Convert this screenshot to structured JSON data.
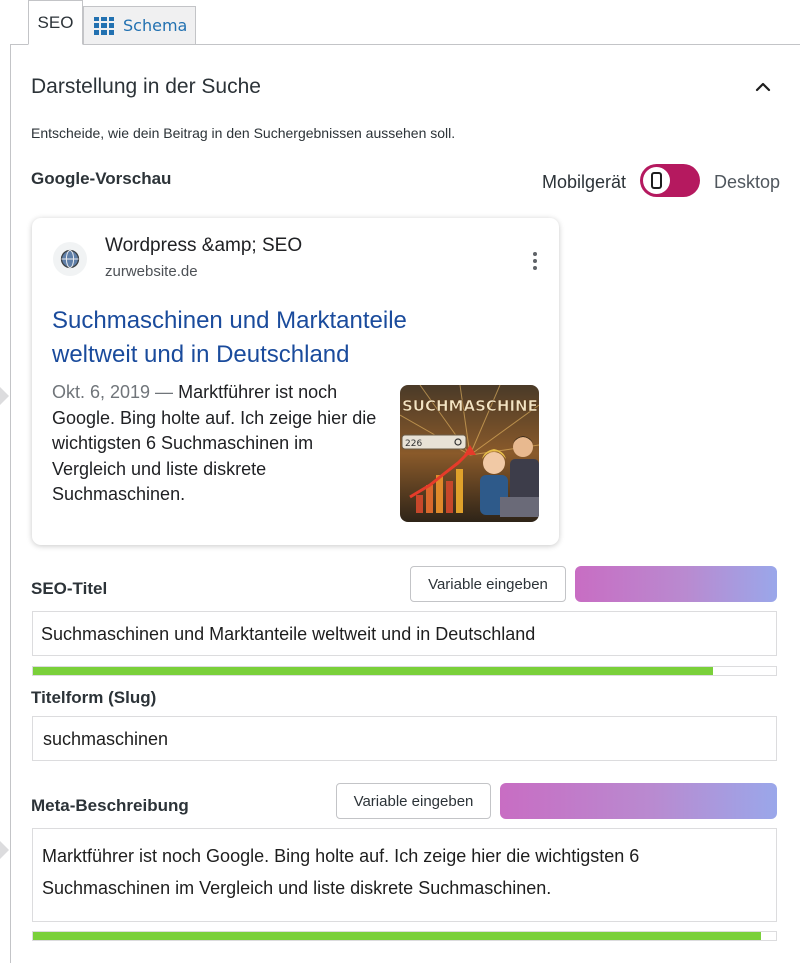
{
  "tabs": [
    {
      "label": "SEO",
      "icon": ""
    },
    {
      "label": "Schema",
      "icon": "grid-icon"
    }
  ],
  "section": {
    "title": "Darstellung in der Suche",
    "description": "Entscheide, wie dein Beitrag in den Suchergebnissen aussehen soll."
  },
  "preview": {
    "label": "Google-Vorschau",
    "mobile_label": "Mobilgerät",
    "desktop_label": "Desktop",
    "toggle_state": "mobile",
    "toggle_color": "#b5195f"
  },
  "serp": {
    "site_name": "Wordpress &amp; SEO",
    "url": "zurwebsite.de",
    "title": "Suchmaschinen und Marktanteile weltweit und in Deutschland",
    "date": "Okt. 6, 2019 —",
    "snippet": "Marktführer ist noch Google. Bing holte auf. Ich zeige hier die wichtigsten 6 Suchmaschinen im Vergleich und liste diskrete Suchmaschinen.",
    "thumbnail_text": "SUCHMASCHINEN",
    "thumbnail_search_text": "226"
  },
  "seo_title": {
    "label": "SEO-Titel",
    "button": "Variable eingeben",
    "value": "Suchmaschinen und Marktanteile weltweit und in Deutschland",
    "progress": 0.915
  },
  "slug": {
    "label": "Titelform (Slug)",
    "value": "suchmaschinen"
  },
  "meta": {
    "label": "Meta-Beschreibung",
    "button": "Variable eingeben",
    "value": "Marktführer ist noch Google. Bing holte auf. Ich zeige hier die wichtigsten 6 Suchmaschinen im Vergleich und liste diskrete Suchmaschinen.",
    "progress": 0.98
  },
  "colors": {
    "progress_good": "#7ad03a",
    "link_title": "#1a4b9c",
    "accent": "#b5195f"
  }
}
